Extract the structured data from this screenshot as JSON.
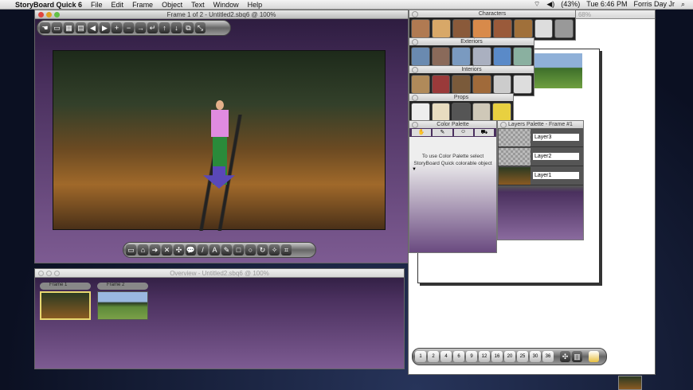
{
  "menubar": {
    "app": "StoryBoard Quick 6",
    "items": [
      "File",
      "Edit",
      "Frame",
      "Object",
      "Text",
      "Window",
      "Help"
    ],
    "battery": "(43%)",
    "clock": "Tue 6:46 PM",
    "user": "Forris Day Jr"
  },
  "main_window": {
    "title": "Frame 1 of 2 - Untitled2.sbq6 @ 100%"
  },
  "overview_window": {
    "title": "Overview - Untitled2.sbq6 @ 100%",
    "frames": [
      {
        "label": "Frame 1"
      },
      {
        "label": "Frame 2"
      }
    ]
  },
  "doc_window": {
    "title_zoom": "@ 68%"
  },
  "palettes": {
    "characters": "Characters",
    "exteriors": "Exteriors",
    "interiors": "Interiors",
    "props": "Props"
  },
  "color_palette": {
    "title": "Color Palette",
    "message": "To use Color Palette select StoryBoard Quick colorable object"
  },
  "layers_palette": {
    "title": "Layers Palette - Frame #1",
    "layers": [
      "Layer3",
      "Layer2",
      "Layer1"
    ]
  },
  "layout_toolbar": {
    "counts": [
      "1",
      "2",
      "4",
      "6",
      "9",
      "12",
      "16",
      "20",
      "25",
      "30",
      "36"
    ]
  },
  "colors": {
    "purple_dark": "#2a1a3c",
    "purple_light": "#7d5b92"
  }
}
